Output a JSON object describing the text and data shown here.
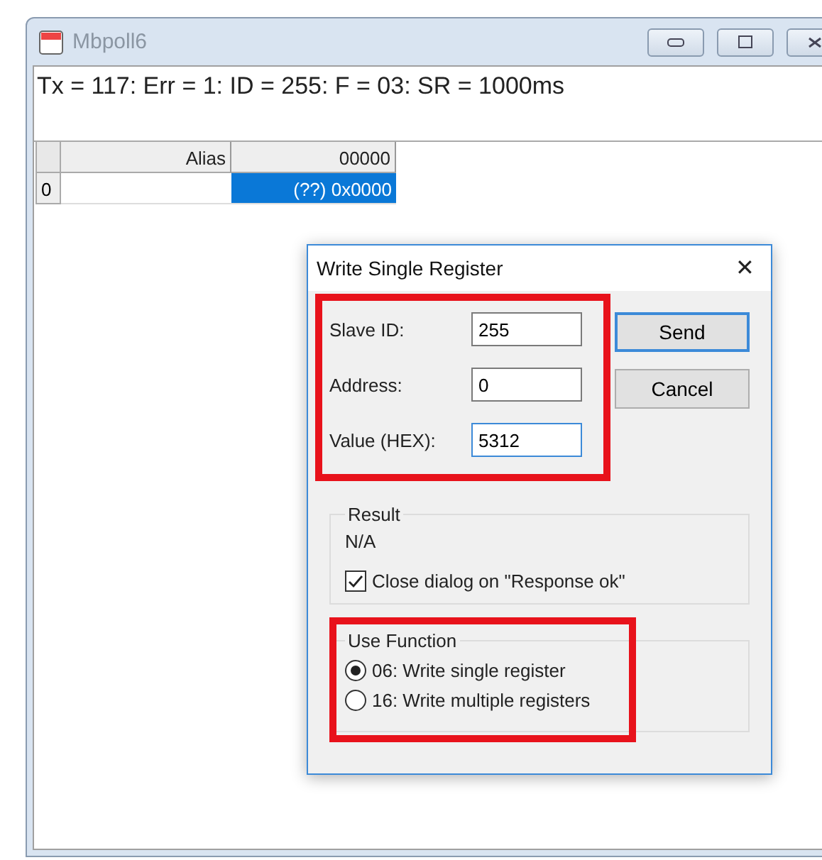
{
  "window": {
    "title": "Mbpoll6",
    "status": "Tx = 117: Err = 1: ID = 255: F = 03: SR = 1000ms"
  },
  "grid": {
    "columns": [
      "Alias",
      "00000"
    ],
    "rows": [
      {
        "header": "0",
        "value": "(??) 0x0000",
        "selected": true
      }
    ]
  },
  "dialog": {
    "title": "Write Single Register",
    "close": "✕",
    "fields_highlighted": true,
    "fields": [
      {
        "label": "Slave ID:",
        "value": "255",
        "focused": false
      },
      {
        "label": "Address:",
        "value": "0",
        "focused": false
      },
      {
        "label": "Value (HEX):",
        "value": "5312",
        "focused": true
      }
    ],
    "buttons": [
      {
        "label": "Send",
        "default": true
      },
      {
        "label": "Cancel",
        "default": false
      }
    ],
    "result": {
      "title": "Result",
      "text": "N/A",
      "checkbox": {
        "label": "Close dialog on \"Response ok\"",
        "checked": true
      }
    },
    "function": {
      "title": "Use Function",
      "highlighted": true,
      "options": [
        {
          "label": "06: Write single register",
          "selected": true
        },
        {
          "label": "16: Write multiple registers",
          "selected": false
        }
      ]
    }
  }
}
